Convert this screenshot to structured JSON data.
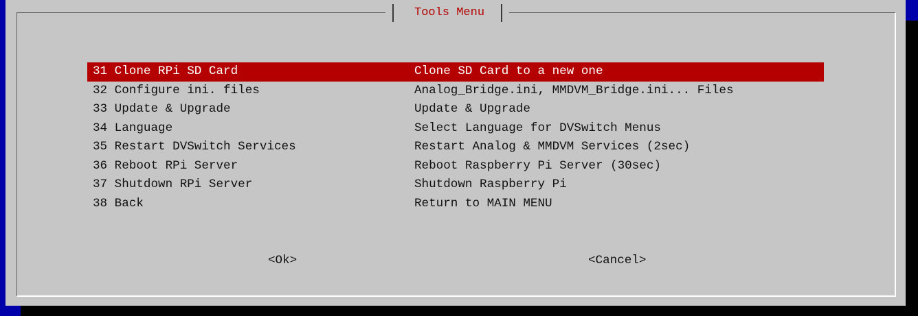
{
  "dialog": {
    "title": "Tools Menu"
  },
  "menu": {
    "items": [
      {
        "tag": "31 Clone RPi SD Card",
        "desc": "Clone SD Card to a new one",
        "selected": true
      },
      {
        "tag": "32 Configure ini. files",
        "desc": "Analog_Bridge.ini, MMDVM_Bridge.ini... Files",
        "selected": false
      },
      {
        "tag": "33 Update & Upgrade",
        "desc": "Update & Upgrade",
        "selected": false
      },
      {
        "tag": "34 Language",
        "desc": "Select Language for DVSwitch Menus",
        "selected": false
      },
      {
        "tag": "35 Restart DVSwitch Services",
        "desc": "Restart Analog & MMDVM Services (2sec)",
        "selected": false
      },
      {
        "tag": "36 Reboot RPi Server",
        "desc": "Reboot Raspberry Pi Server (30sec)",
        "selected": false
      },
      {
        "tag": "37 Shutdown RPi Server",
        "desc": "Shutdown Raspberry Pi",
        "selected": false
      },
      {
        "tag": "38 Back",
        "desc": "Return to MAIN MENU",
        "selected": false
      }
    ]
  },
  "buttons": {
    "ok_label": "<Ok>",
    "cancel_label": "<Cancel>"
  },
  "colors": {
    "screen_background": "#0000aa",
    "dialog_background": "#c6c6c6",
    "selection_background": "#b40000",
    "title_text": "#b40000"
  }
}
